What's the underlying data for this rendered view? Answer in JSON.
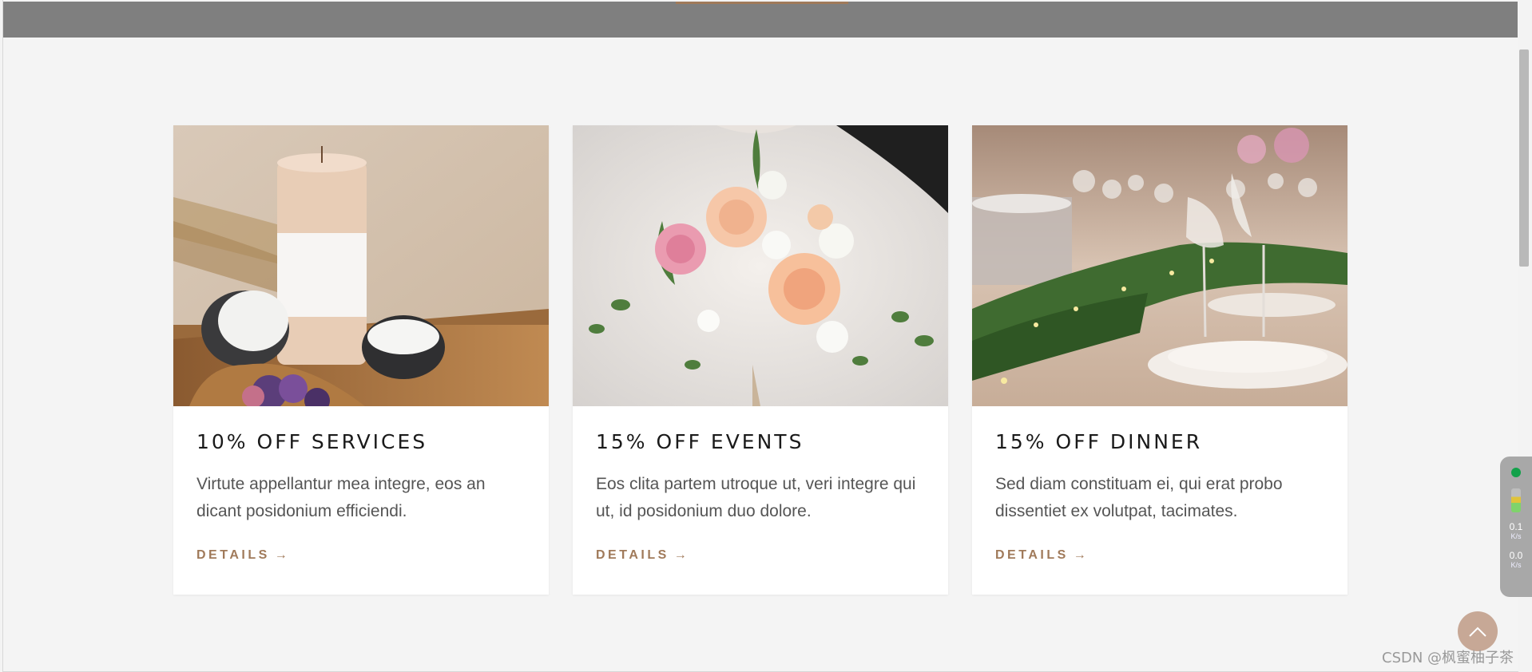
{
  "cards": [
    {
      "title": "10% OFF SERVICES",
      "text": "Virtute appellantur mea integre, eos an dicant posidonium efficiendi.",
      "link": "DETAILS",
      "image": "candles-photo"
    },
    {
      "title": "15% OFF EVENTS",
      "text": "Eos clita partem utroque ut, veri integre qui ut, id posidonium duo dolore.",
      "link": "DETAILS",
      "image": "bouquet-photo"
    },
    {
      "title": "15% OFF DINNER",
      "text": "Sed diam constituam ei, qui erat probo dissentiet ex volutpat, tacimates.",
      "link": "DETAILS",
      "image": "dinner-table-photo"
    }
  ],
  "arrow": "→",
  "net_widget": {
    "up": "0.1",
    "up_unit": "K/s",
    "down": "0.0",
    "down_unit": "K/s"
  },
  "watermark": "CSDN @枫蜜柚子茶",
  "colors": {
    "accent": "#a07a5a",
    "topbar": "#7f7f7f",
    "background": "#f4f4f4",
    "card": "#ffffff"
  }
}
